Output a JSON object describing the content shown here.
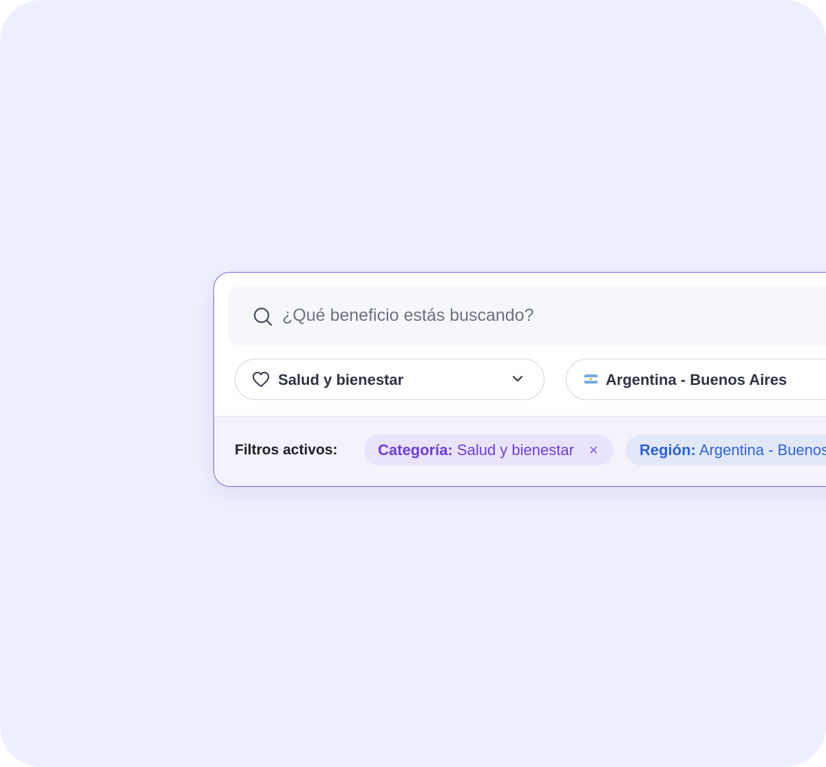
{
  "search": {
    "placeholder": "¿Qué beneficio estás buscando?",
    "icon": "search-icon"
  },
  "filters": {
    "category": {
      "icon": "heart-icon",
      "label": "Salud y bienestar",
      "chevron_icon": "chevron-down-icon"
    },
    "region": {
      "icon": "argentina-flag-icon",
      "label": "Argentina - Buenos Aires"
    }
  },
  "active_filters": {
    "label": "Filtros activos:",
    "chips": [
      {
        "key": "Categoría:",
        "value": "Salud y bienestar",
        "close_icon": "close-icon",
        "close_glyph": "×"
      },
      {
        "key": "Región:",
        "value": "Argentina - Buenos Aires"
      }
    ]
  },
  "colors": {
    "background": "#eeeffc",
    "panel_border": "#7b5fd6",
    "category_chip_bg": "#e9e3fb",
    "category_chip_text": "#6d3fd3",
    "region_chip_bg": "#e2e8f8",
    "region_chip_text": "#2f63d4"
  }
}
